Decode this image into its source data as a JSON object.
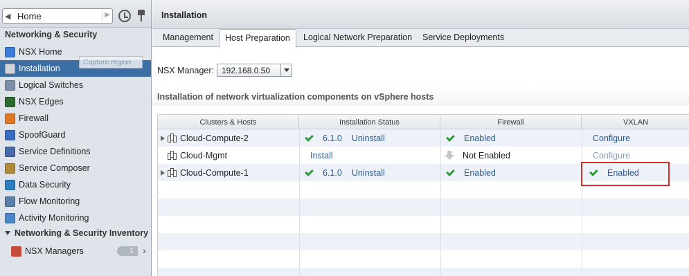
{
  "nav": {
    "home_label": "Home",
    "section_title": "Networking & Security",
    "tooltip": "Capture region",
    "items": [
      {
        "label": "NSX Home",
        "icon": "nsx-home-icon",
        "color": "#3b7dd8"
      },
      {
        "label": "Installation",
        "icon": "gear-icon",
        "color": "#d0d4da",
        "active": true
      },
      {
        "label": "Logical Switches",
        "icon": "logical-switch-icon",
        "color": "#7a8fa8"
      },
      {
        "label": "NSX Edges",
        "icon": "nsx-edge-icon",
        "color": "#2d6a2d"
      },
      {
        "label": "Firewall",
        "icon": "firewall-icon",
        "color": "#e0782a"
      },
      {
        "label": "SpoofGuard",
        "icon": "spoofguard-icon",
        "color": "#3a6cc0"
      },
      {
        "label": "Service Definitions",
        "icon": "service-definitions-icon",
        "color": "#4a6ba8"
      },
      {
        "label": "Service Composer",
        "icon": "service-composer-icon",
        "color": "#b08a3a"
      },
      {
        "label": "Data Security",
        "icon": "data-security-icon",
        "color": "#2d7ec2"
      },
      {
        "label": "Flow Monitoring",
        "icon": "flow-monitoring-icon",
        "color": "#5a7fa8"
      },
      {
        "label": "Activity Monitoring",
        "icon": "activity-monitoring-icon",
        "color": "#4a86c8"
      }
    ],
    "inventory_title": "Networking & Security Inventory",
    "nsx_managers_label": "NSX Managers",
    "nsx_managers_count": "1"
  },
  "main": {
    "title": "Installation",
    "tabs": [
      "Management",
      "Host Preparation",
      "Logical Network Preparation",
      "Service Deployments"
    ],
    "active_tab": "Host Preparation",
    "nsx_manager_label": "NSX Manager:",
    "nsx_manager_value": "192.168.0.50",
    "section_title": "Installation of network virtualization components on vSphere hosts",
    "columns": [
      "Clusters & Hosts",
      "Installation Status",
      "Firewall",
      "VXLAN"
    ],
    "rows": [
      {
        "name": "Cloud-Compute-2",
        "expandable": true,
        "version": "6.1.0",
        "status_action": "Uninstall",
        "firewall": "Enabled",
        "firewall_enabled": true,
        "vxlan": "Configure",
        "vxlan_state": "link"
      },
      {
        "name": "Cloud-Mgmt",
        "expandable": false,
        "version": "",
        "status_action": "Install",
        "firewall": "Not Enabled",
        "firewall_enabled": false,
        "vxlan": "Configure",
        "vxlan_state": "disabled"
      },
      {
        "name": "Cloud-Compute-1",
        "expandable": true,
        "version": "6.1.0",
        "status_action": "Uninstall",
        "firewall": "Enabled",
        "firewall_enabled": true,
        "vxlan": "Enabled",
        "vxlan_state": "enabled"
      }
    ],
    "colors": {
      "accent": "#3b6ea5",
      "link": "#2a5a9a",
      "check": "#2e9a3a",
      "highlight": "#d62b2b"
    }
  }
}
